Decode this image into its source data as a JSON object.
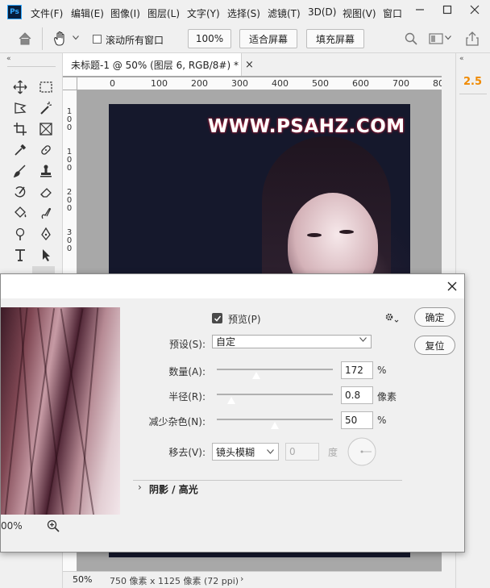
{
  "app": {
    "logo": "Ps"
  },
  "menu": [
    "文件(F)",
    "编辑(E)",
    "图像(I)",
    "图层(L)",
    "文字(Y)",
    "选择(S)",
    "滤镜(T)",
    "3D(D)",
    "视图(V)",
    "窗口"
  ],
  "options": {
    "scroll_all_windows": "滚动所有窗口",
    "zoom": "100%",
    "fit_screen": "适合屏幕",
    "fill_screen": "填充屏幕"
  },
  "document": {
    "tab_title": "未标题-1 @ 50% (图层 6, RGB/8#) *",
    "watermark": "WWW.PSAHZ.COM",
    "ruler_h": [
      "0",
      "100",
      "200",
      "300",
      "400",
      "500",
      "600",
      "700",
      "80"
    ],
    "ruler_v": [
      "1\n0\n0",
      "1\n0\n0",
      "2\n0\n0",
      "3\n0\n0"
    ]
  },
  "status": {
    "zoom": "50%",
    "info": "750 像素 x 1125 像素 (72 ppi)"
  },
  "right_panel": {
    "value": "2.5"
  },
  "dialog": {
    "preview_label": "预览(P)",
    "preview_checked": true,
    "ok": "确定",
    "reset": "复位",
    "preset_label": "预设(S):",
    "preset_value": "自定",
    "amount_label": "数量(A):",
    "amount_value": "172",
    "amount_unit": "%",
    "radius_label": "半径(R):",
    "radius_value": "0.8",
    "radius_unit": "像素",
    "noise_label": "减少杂色(N):",
    "noise_value": "50",
    "noise_unit": "%",
    "remove_label": "移去(V):",
    "remove_value": "镜头模糊",
    "angle_value": "0",
    "angle_unit": "度",
    "shadow_section": "阴影 / 高光",
    "preview_zoom": "00%"
  }
}
